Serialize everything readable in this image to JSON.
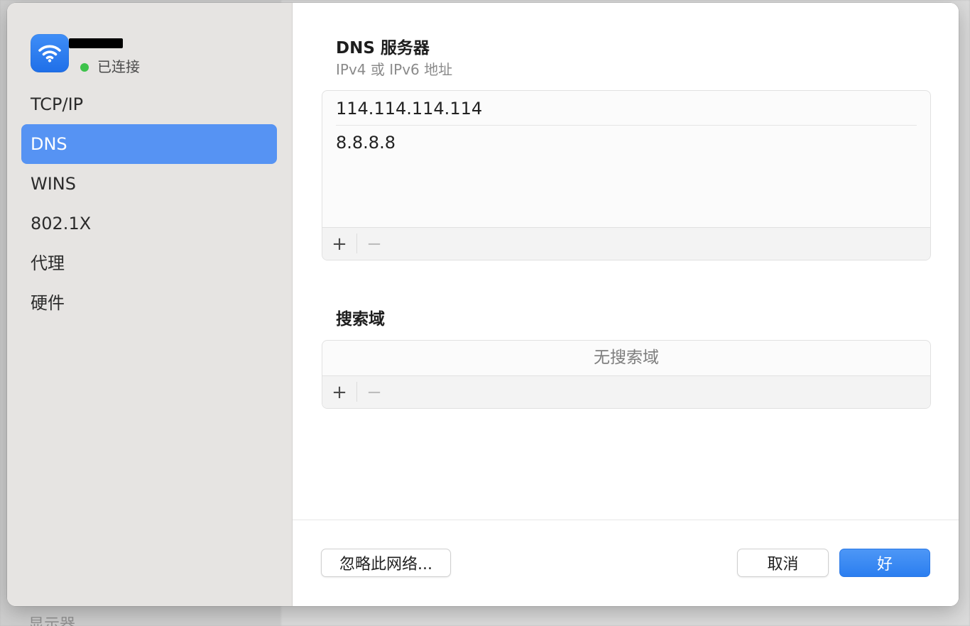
{
  "background": {
    "bottom_text": "显示器"
  },
  "sidebar": {
    "network_status": "已连接",
    "items": [
      {
        "label": "TCP/IP",
        "active": false
      },
      {
        "label": "DNS",
        "active": true
      },
      {
        "label": "WINS",
        "active": false
      },
      {
        "label": "802.1X",
        "active": false
      },
      {
        "label": "代理",
        "active": false
      },
      {
        "label": "硬件",
        "active": false
      }
    ]
  },
  "dns": {
    "title": "DNS 服务器",
    "subtitle": "IPv4 或 IPv6 地址",
    "servers": [
      "114.114.114.114",
      "8.8.8.8"
    ],
    "add_label": "+",
    "remove_label": "−"
  },
  "search_domains": {
    "title": "搜索域",
    "empty_label": "无搜索域",
    "add_label": "+",
    "remove_label": "−"
  },
  "footer": {
    "ignore_label": "忽略此网络...",
    "cancel_label": "取消",
    "ok_label": "好"
  },
  "colors": {
    "accent": "#5693f3",
    "status_connected": "#3ec24b",
    "primary_button": "#2b7ef0"
  },
  "icons": {
    "network": "wifi-icon"
  }
}
